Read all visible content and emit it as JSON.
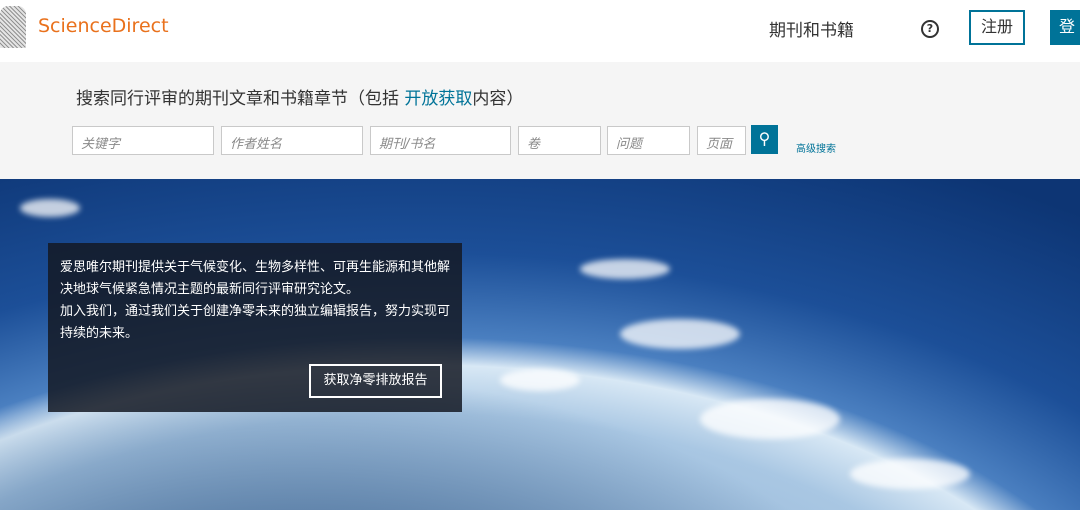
{
  "header": {
    "logo": "ScienceDirect",
    "nav_link": "期刊和书籍",
    "help": "?",
    "register": "注册",
    "login": "登"
  },
  "search": {
    "title_pre": "搜索同行评审的期刊文章和书籍章节（包括 ",
    "title_link": "开放获取",
    "title_post": "内容）",
    "placeholders": {
      "keyword": "关键字",
      "author": "作者姓名",
      "journal": "期刊/书名",
      "volume": "卷",
      "issue": "问题",
      "pages": "页面"
    },
    "advanced": "高级搜索"
  },
  "promo": {
    "text1": "爱思唯尔期刊提供关于气候变化、生物多样性、可再生能源和其他解决地球气候紧急情况主题的最新同行评审研究论文。",
    "text2": "加入我们，通过我们关于创建净零未来的独立编辑报告，努力实现可持续的未来。",
    "button": "获取净零排放报告"
  }
}
